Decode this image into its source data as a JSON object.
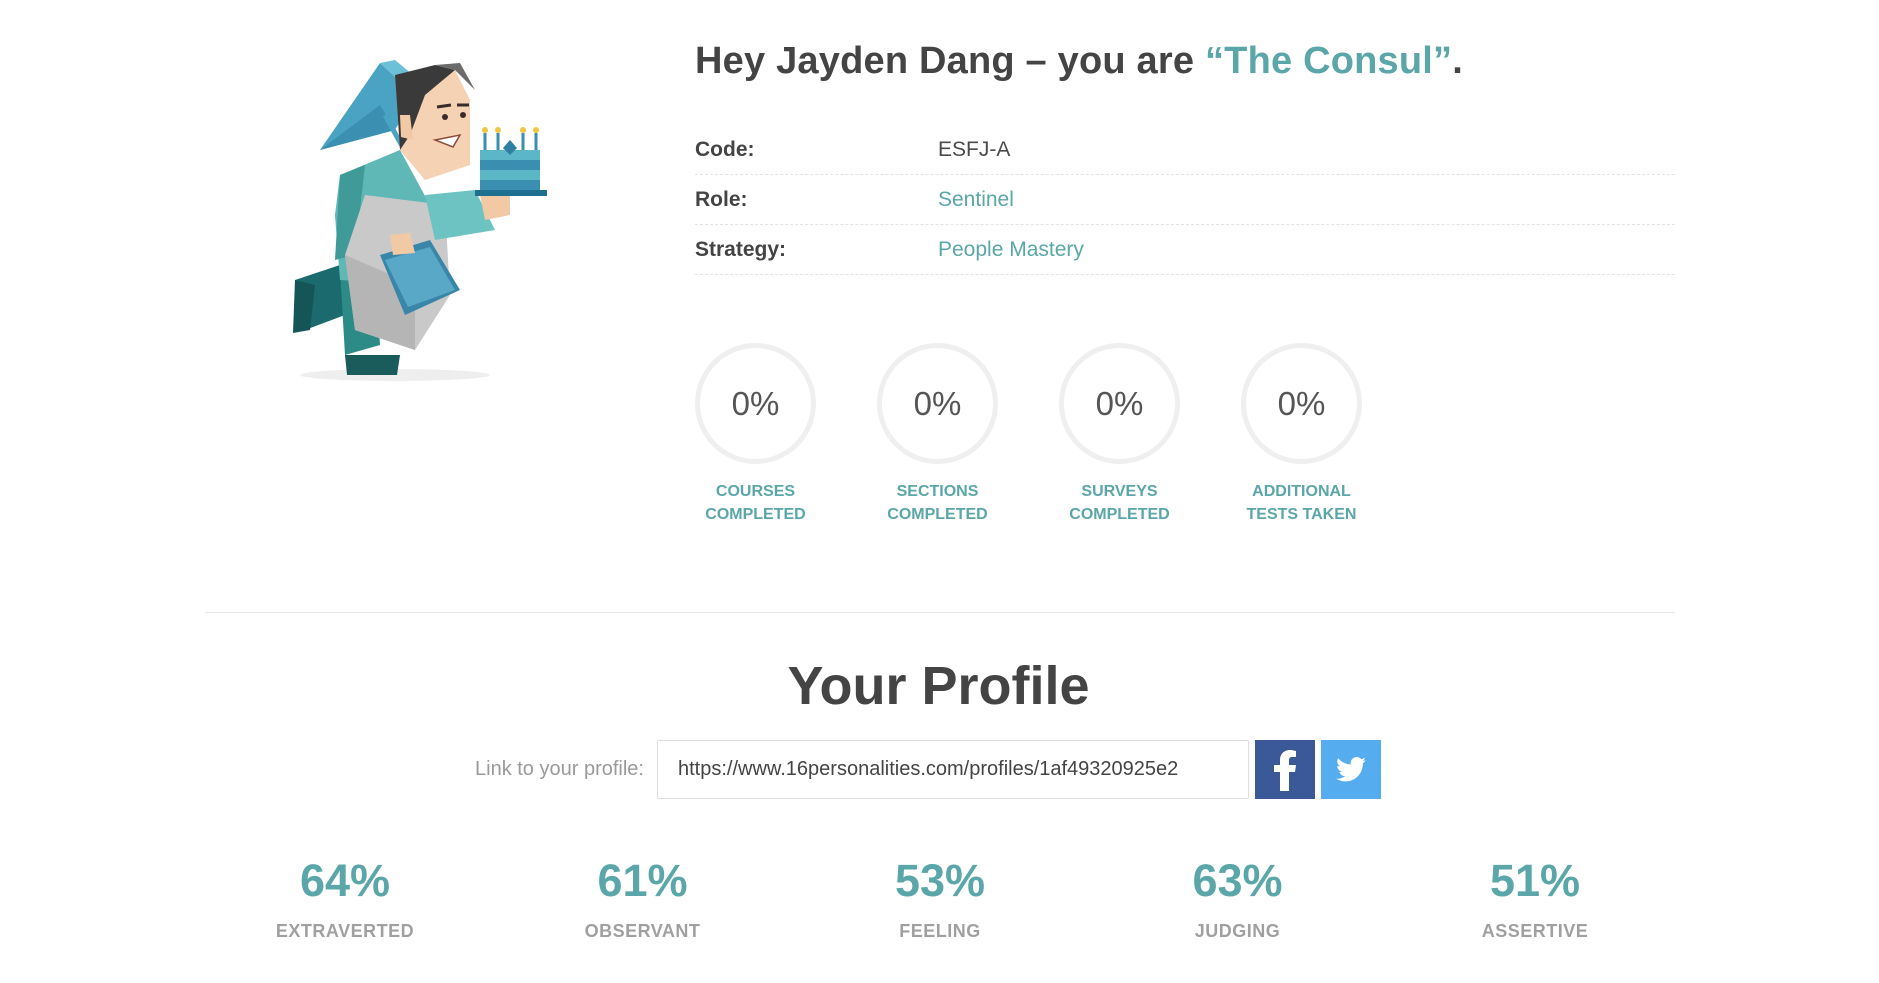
{
  "header": {
    "greeting_prefix": "Hey Jayden Dang – you are ",
    "personality_type": "“The Consul”",
    "greeting_suffix": "."
  },
  "info": {
    "code_label": "Code:",
    "code_value": "ESFJ-A",
    "role_label": "Role:",
    "role_value": "Sentinel",
    "strategy_label": "Strategy:",
    "strategy_value": "People Mastery"
  },
  "stats": [
    {
      "value": "0%",
      "label": "COURSES\nCOMPLETED"
    },
    {
      "value": "0%",
      "label": "SECTIONS\nCOMPLETED"
    },
    {
      "value": "0%",
      "label": "SURVEYS\nCOMPLETED"
    },
    {
      "value": "0%",
      "label": "ADDITIONAL\nTESTS TAKEN"
    }
  ],
  "profile": {
    "title": "Your Profile",
    "link_label": "Link to your profile:",
    "link_value": "https://www.16personalities.com/profiles/1af49320925e2"
  },
  "traits": [
    {
      "value": "64%",
      "label": "EXTRAVERTED"
    },
    {
      "value": "61%",
      "label": "OBSERVANT"
    },
    {
      "value": "53%",
      "label": "FEELING"
    },
    {
      "value": "63%",
      "label": "JUDGING"
    },
    {
      "value": "51%",
      "label": "ASSERTIVE"
    }
  ],
  "colors": {
    "accent": "#5aa6a8",
    "facebook": "#3b5998",
    "twitter": "#55acee"
  },
  "icons": {
    "illustration": "consul-character-illustration",
    "facebook": "facebook-icon",
    "twitter": "twitter-icon"
  }
}
